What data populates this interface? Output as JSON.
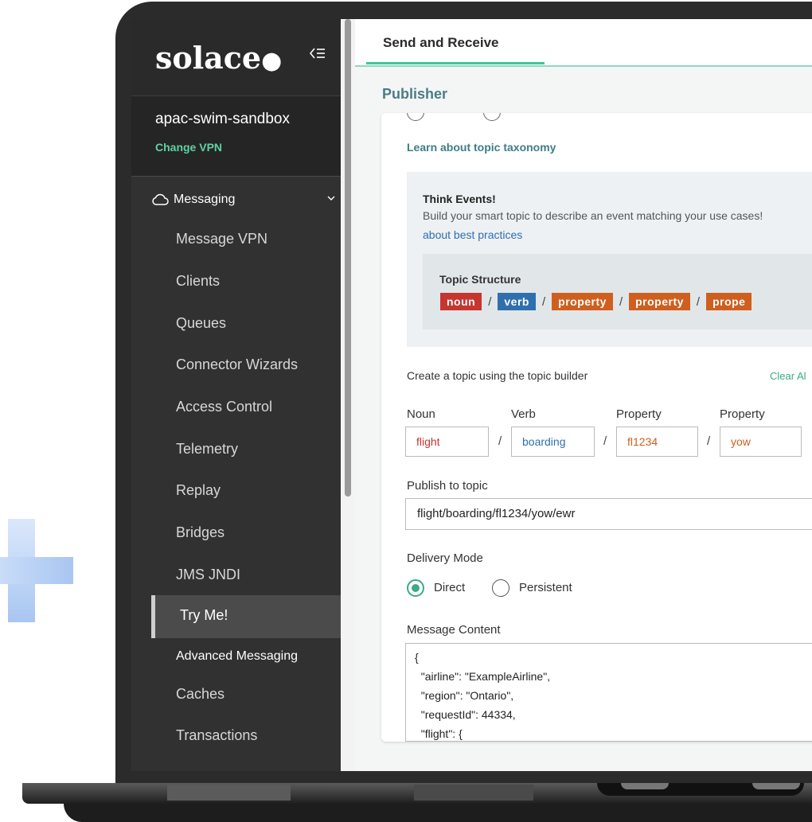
{
  "sidebar": {
    "logo": "solace",
    "collapse_icon": "collapse-menu-icon",
    "vpn_name": "apac-swim-sandbox",
    "change_vpn": "Change VPN",
    "section": "Messaging",
    "items": [
      "Message VPN",
      "Clients",
      "Queues",
      "Connector Wizards",
      "Access Control",
      "Telemetry",
      "Replay",
      "Bridges",
      "JMS JNDI",
      "Try Me!",
      "Advanced Messaging",
      "Caches",
      "Transactions"
    ],
    "active_item": "Try Me!"
  },
  "main": {
    "tab": "Send and Receive",
    "section_title": "Publisher",
    "learn_link": "Learn about topic taxonomy",
    "think": {
      "title": "Think Events!",
      "description": "Build your smart topic to describe an event matching your use cases!",
      "link": "about best practices"
    },
    "topic_structure": {
      "title": "Topic Structure",
      "chips": [
        "noun",
        "verb",
        "property",
        "property",
        "prope"
      ],
      "separator": "/"
    },
    "builder": {
      "label": "Create a topic using the topic builder",
      "clear_all": "Clear Al",
      "columns": [
        "Noun",
        "Verb",
        "Property",
        "Property"
      ],
      "values": [
        "flight",
        "boarding",
        "fl1234",
        "yow"
      ]
    },
    "publish": {
      "label": "Publish to topic",
      "value": "flight/boarding/fl1234/yow/ewr"
    },
    "delivery": {
      "label": "Delivery Mode",
      "options": [
        "Direct",
        "Persistent"
      ],
      "selected": "Direct"
    },
    "message": {
      "label": "Message Content",
      "lines": [
        "{",
        "  \"airline\": \"ExampleAirline\",",
        "  \"region\": \"Ontario\",",
        "  \"requestId\": 44334,",
        "  \"flight\": {"
      ]
    }
  },
  "colors": {
    "accent": "#3caa86",
    "noun": "#c7352f",
    "verb": "#2f6fae",
    "property": "#cf5f1f"
  }
}
